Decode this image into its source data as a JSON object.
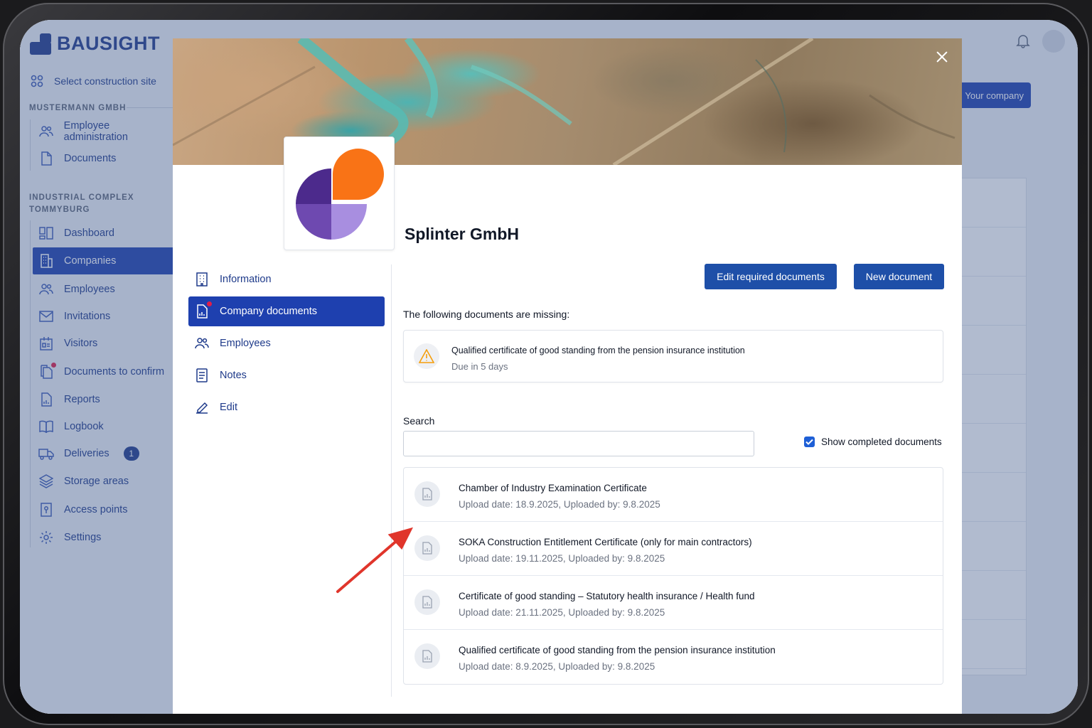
{
  "app": {
    "brand": "BAUSIGHT",
    "select_site": "Select construction site",
    "sections": [
      {
        "title": "MUSTERMANN GMBH",
        "items": [
          "Employee administration",
          "Documents"
        ]
      },
      {
        "title": "INDUSTRIAL COMPLEX TOMMYBURG",
        "items": [
          "Dashboard",
          "Companies",
          "Employees",
          "Invitations",
          "Visitors",
          "Documents to confirm",
          "Reports",
          "Logbook",
          "Deliveries",
          "Storage areas",
          "Access points",
          "Settings"
        ]
      }
    ],
    "deliveries_count": "1",
    "your_company_label": "Your company",
    "active_item": "Companies"
  },
  "modal": {
    "company_name": "Splinter GmbH",
    "nav": [
      {
        "label": "Information",
        "icon": "building-icon"
      },
      {
        "label": "Company documents",
        "icon": "document-icon"
      },
      {
        "label": "Employees",
        "icon": "users-icon"
      },
      {
        "label": "Notes",
        "icon": "notes-icon"
      },
      {
        "label": "Edit",
        "icon": "pencil-icon"
      }
    ],
    "active_nav": "Company documents",
    "buttons": {
      "edit_required": "Edit required documents",
      "new_document": "New document"
    },
    "missing_title": "The following documents are missing:",
    "missing": {
      "name": "Qualified certificate of good standing from the pension insurance institution",
      "due": "Due in 5 days"
    },
    "search_label": "Search",
    "search_value": "",
    "show_completed_label": "Show completed documents",
    "show_completed_checked": true,
    "documents": [
      {
        "name": "Chamber of Industry Examination Certificate",
        "meta": "Upload date: 18.9.2025, Uploaded by: 9.8.2025"
      },
      {
        "name": "SOKA Construction Entitlement Certificate (only for main contractors)",
        "meta": "Upload date: 19.11.2025, Uploaded by: 9.8.2025"
      },
      {
        "name": "Certificate of good standing – Statutory health insurance / Health fund",
        "meta": "Upload date: 21.11.2025, Uploaded by: 9.8.2025"
      },
      {
        "name": "Qualified certificate of good standing from the pension insurance institution",
        "meta": "Upload date: 8.9.2025, Uploaded by: 9.8.2025"
      }
    ]
  },
  "colors": {
    "primary": "#1e40af",
    "primary_button": "#1e4fa8",
    "warning": "#f59e0b",
    "arrow": "#e0352b",
    "logo_orange": "#f97316",
    "logo_purple_dark": "#4c2a8c",
    "logo_purple_mid": "#6e49b0",
    "logo_purple_light": "#a88ee0"
  }
}
